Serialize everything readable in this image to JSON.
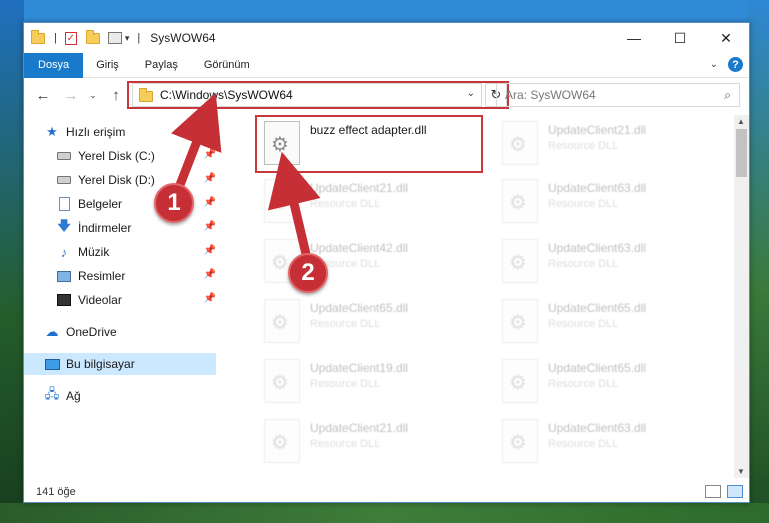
{
  "window": {
    "title": "SysWOW64",
    "controls": {
      "minimize": "—",
      "maximize": "☐",
      "close": "✕"
    }
  },
  "quick_access": {
    "bar": "|",
    "dropdown": "▾"
  },
  "ribbon": {
    "tabs": [
      {
        "label": "Dosya",
        "active": true
      },
      {
        "label": "Giriş"
      },
      {
        "label": "Paylaş"
      },
      {
        "label": "Görünüm"
      }
    ],
    "collapse": "⌄",
    "help": "?"
  },
  "nav": {
    "back": "←",
    "forward": "→",
    "recent": "⌄",
    "up": "↑"
  },
  "address": {
    "path": "C:\\Windows\\SysWOW64",
    "dropdown": "⌄",
    "refresh": "↻"
  },
  "search": {
    "placeholder": "Ara: SysWOW64",
    "icon": "⌕"
  },
  "sidebar": {
    "items": [
      {
        "label": "Hızlı erişim"
      },
      {
        "label": "Yerel Disk (C:)",
        "pinned": true
      },
      {
        "label": "Yerel Disk (D:)",
        "pinned": true
      },
      {
        "label": "Belgeler",
        "pinned": true
      },
      {
        "label": "İndirmeler",
        "pinned": true
      },
      {
        "label": "Müzik",
        "pinned": true
      },
      {
        "label": "Resimler",
        "pinned": true
      },
      {
        "label": "Videolar",
        "pinned": true
      },
      {
        "label": "OneDrive"
      },
      {
        "label": "Bu bilgisayar",
        "selected": true
      },
      {
        "label": "Ağ"
      }
    ],
    "pin_glyph": "📌"
  },
  "files": {
    "primary": {
      "name": "buzz effect adapter.dll",
      "type": ""
    },
    "col1": [
      {
        "name": "UpdateClient21.dll",
        "type": "Resource DLL"
      },
      {
        "name": "UpdateClient42.dll",
        "type": "Resource DLL"
      },
      {
        "name": "UpdateClient65.dll",
        "type": "Resource DLL"
      },
      {
        "name": "UpdateClient19.dll",
        "type": "Resource DLL"
      },
      {
        "name": "UpdateClient21.dll",
        "type": "Resource DLL"
      }
    ],
    "col2": [
      {
        "name": "UpdateClient21.dll",
        "type": "Resource DLL"
      },
      {
        "name": "UpdateClient63.dll",
        "type": "Resource DLL"
      },
      {
        "name": "UpdateClient63.dll",
        "type": "Resource DLL"
      },
      {
        "name": "UpdateClient65.dll",
        "type": "Resource DLL"
      },
      {
        "name": "UpdateClient65.dll",
        "type": "Resource DLL"
      },
      {
        "name": "UpdateClient63.dll",
        "type": "Resource DLL"
      }
    ]
  },
  "status": {
    "count": "141 öğe"
  },
  "annotations": {
    "step1": "1",
    "step2": "2",
    "highlight_color": "#c8373c"
  },
  "colors": {
    "accent": "#1979ca",
    "selection": "#cce8ff"
  }
}
